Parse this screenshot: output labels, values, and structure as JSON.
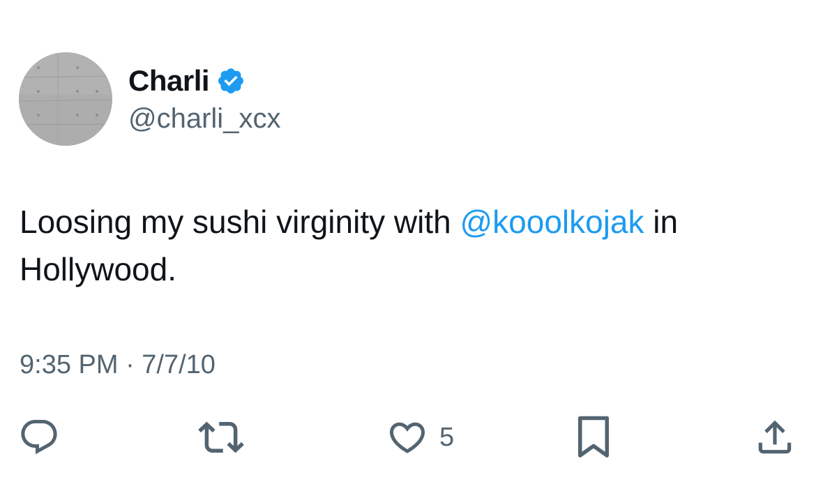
{
  "author": {
    "display_name": "Charli",
    "handle": "@charli_xcx",
    "verified": true,
    "avatar_icon": "concrete-wall-avatar"
  },
  "tweet": {
    "text_before": "Loosing my sushi virginity with ",
    "mention": "@kooolkojak",
    "text_after": " in Hollywood.",
    "timestamp": "9:35 PM · 7/7/10"
  },
  "actions": {
    "reply_icon": "reply-icon",
    "retweet_icon": "retweet-icon",
    "like_icon": "heart-icon",
    "like_count": "5",
    "bookmark_icon": "bookmark-icon",
    "share_icon": "share-icon"
  },
  "colors": {
    "text": "#0f1419",
    "secondary": "#536471",
    "accent": "#1d9bf0"
  }
}
